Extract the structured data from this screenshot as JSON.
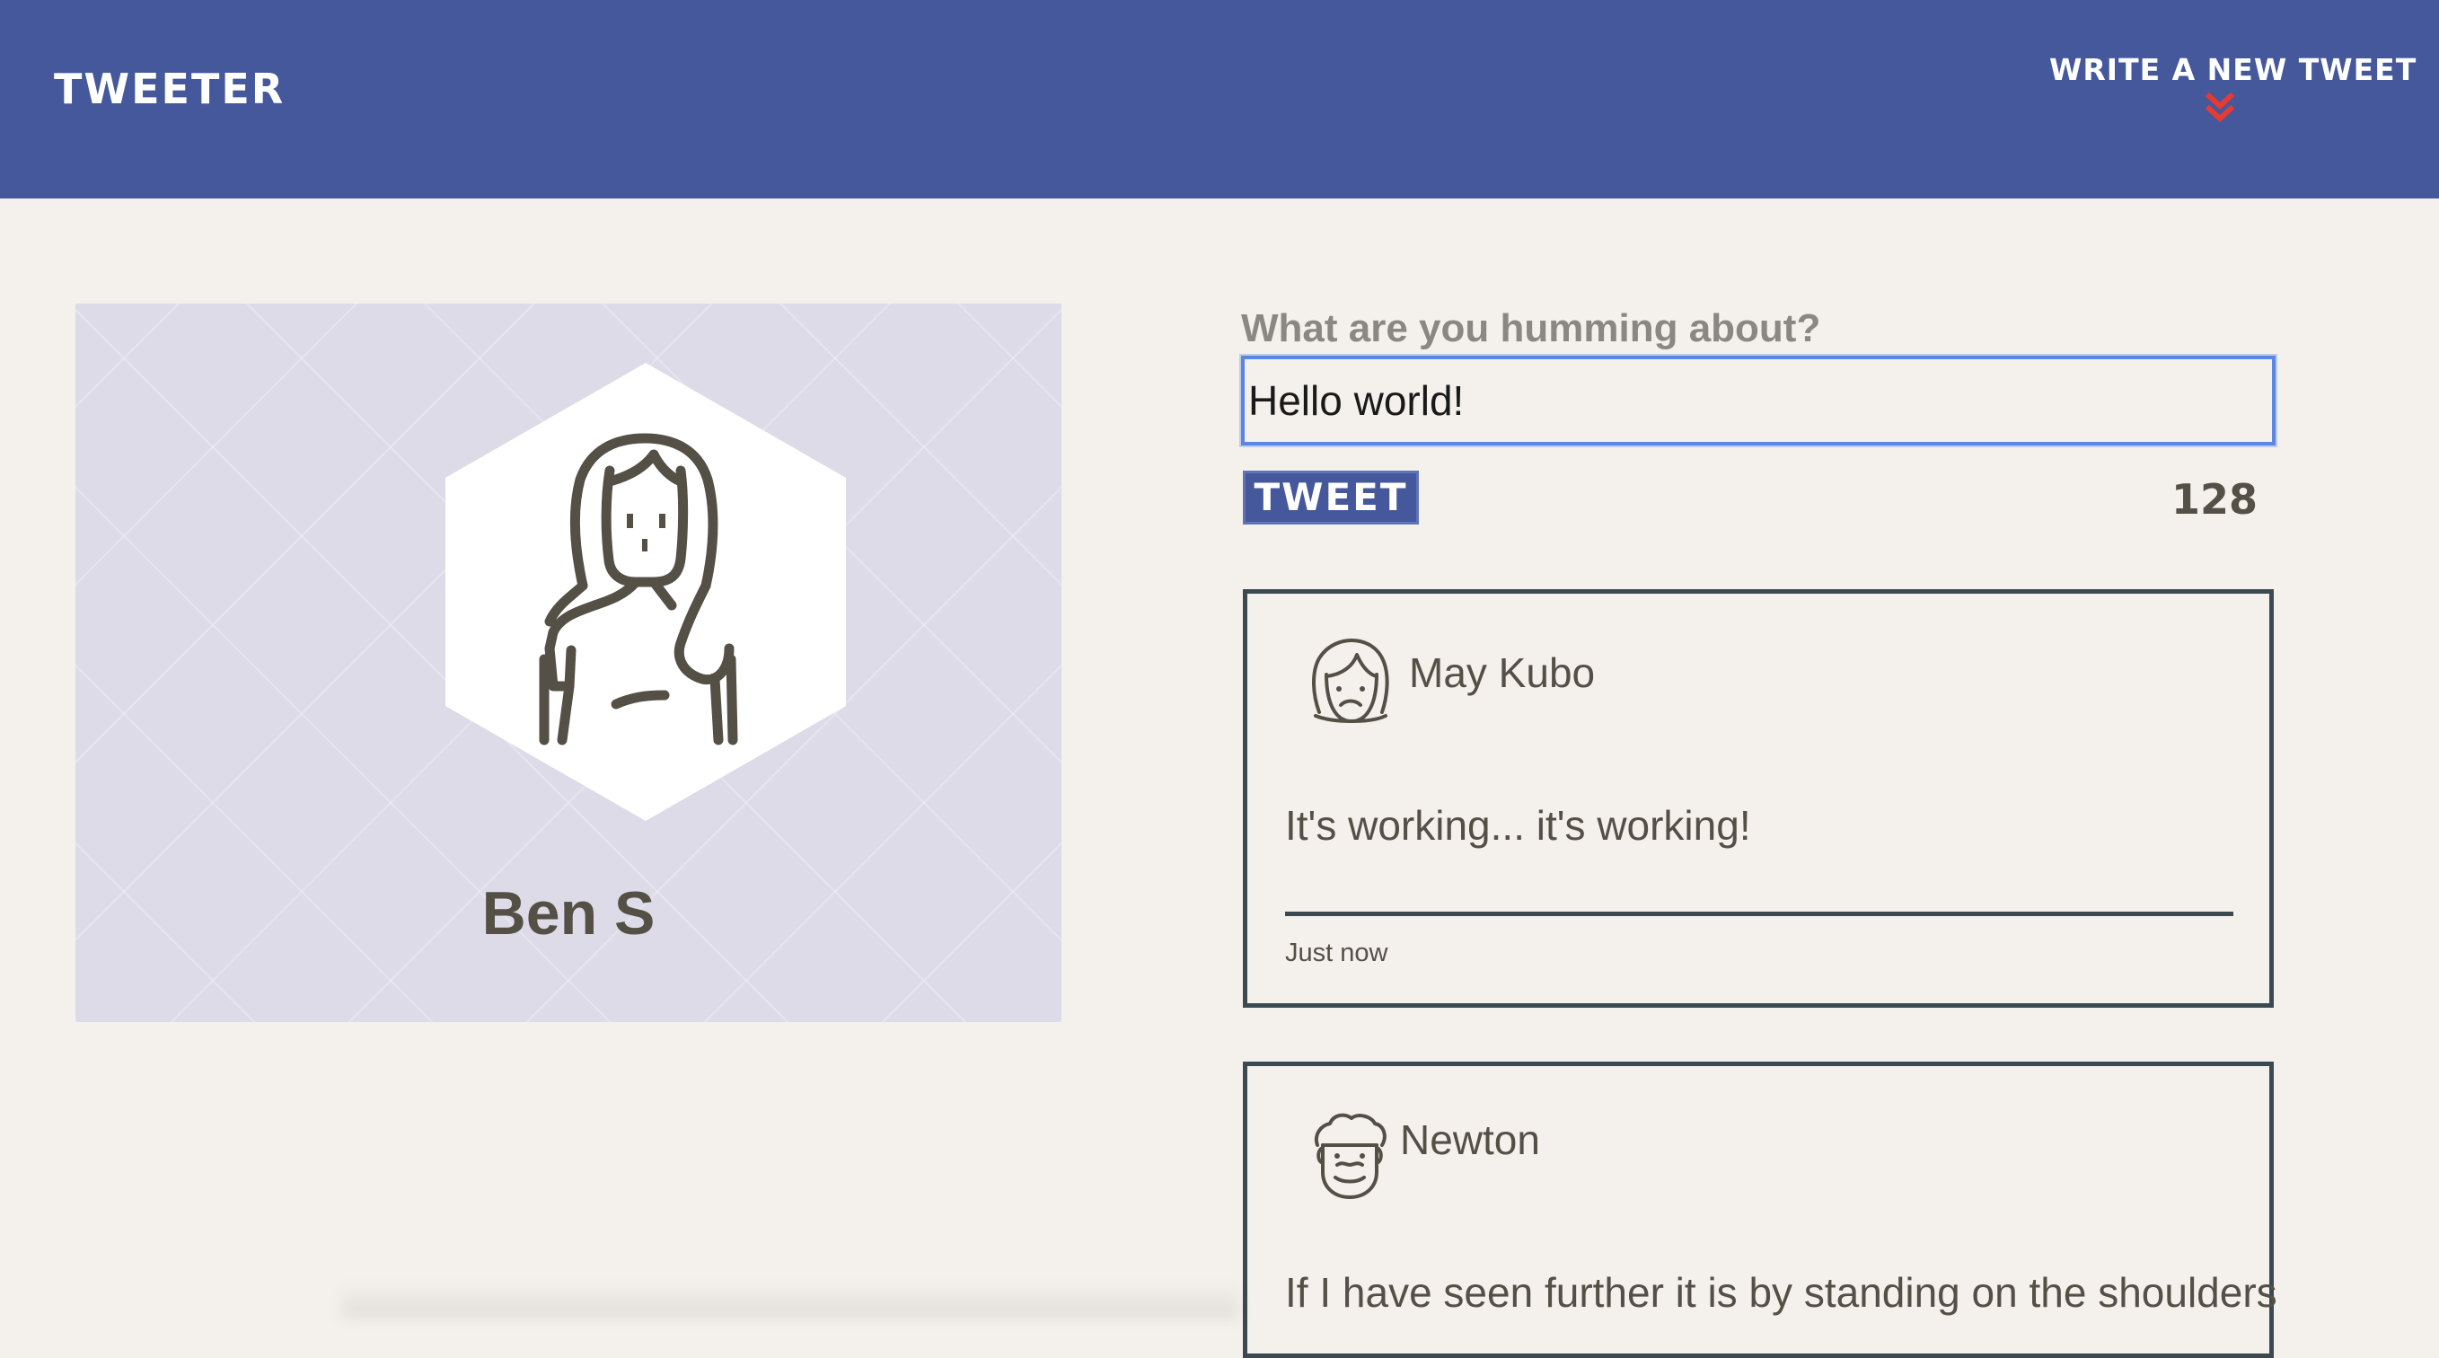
{
  "header": {
    "brand": "TWEETER",
    "compose_link": "WRITE A NEW TWEET",
    "compose_icon": "double-chevron-down-icon"
  },
  "profile": {
    "name": "Ben S",
    "avatar_icon": "woman-avatar-icon"
  },
  "composer": {
    "label": "What are you humming about?",
    "value": "Hello world!",
    "submit_label": "TWEET",
    "char_count": "128"
  },
  "tweets": [
    {
      "author": "May Kubo",
      "avatar_icon": "frowning-woman-avatar-icon",
      "text": "It's working... it's working!",
      "time": "Just now"
    },
    {
      "author": "Newton",
      "avatar_icon": "curly-hair-man-avatar-icon",
      "text": "If I have seen further it is by standing on the shoulders"
    }
  ],
  "colors": {
    "header_bg": "#44589b",
    "page_bg": "#f4f1ed",
    "accent_red": "#e53b33",
    "text_dark": "#555046",
    "card_border": "#3a4a50"
  }
}
